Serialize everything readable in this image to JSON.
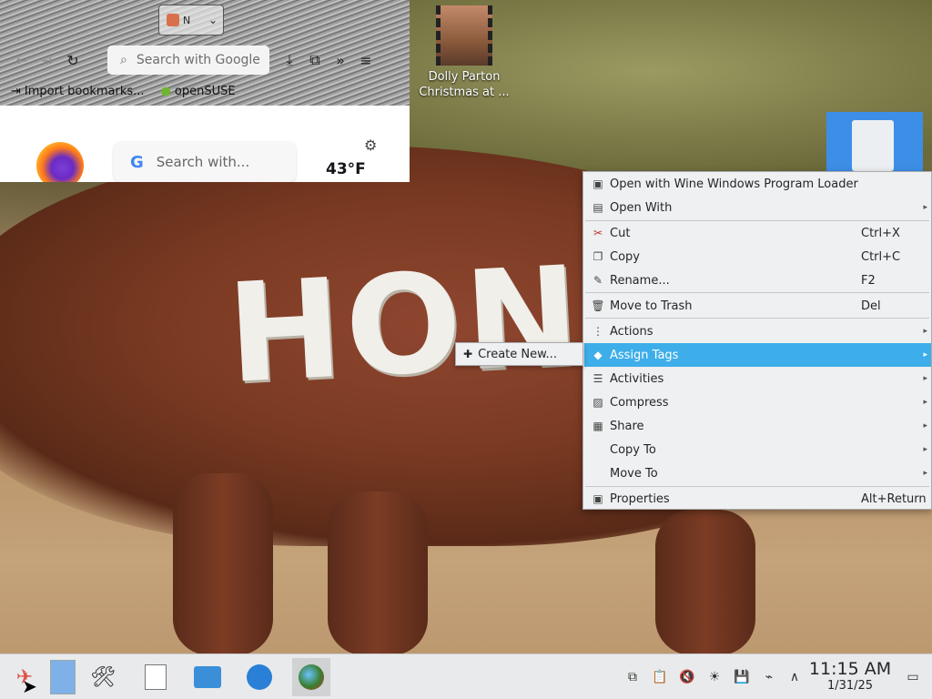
{
  "desktop": {
    "wallpaper_text": "HONS",
    "icon_label": "Dolly Parton Christmas at ..."
  },
  "firefox": {
    "tab_label": "N",
    "url_placeholder": "Search with Google",
    "bookmarks": [
      "Import bookmarks...",
      "openSUSE"
    ],
    "search_placeholder": "Search with...",
    "temperature": "43°F"
  },
  "context_menu": {
    "items": [
      {
        "label": "Open with Wine Windows Program Loader",
        "shortcut": "",
        "icon": "wine-icon",
        "submenu": false
      },
      {
        "label": "Open With",
        "shortcut": "",
        "icon": "open-with-icon",
        "submenu": true
      },
      {
        "label": "Cut",
        "shortcut": "Ctrl+X",
        "icon": "scissors-icon",
        "submenu": false
      },
      {
        "label": "Copy",
        "shortcut": "Ctrl+C",
        "icon": "copy-icon",
        "submenu": false
      },
      {
        "label": "Rename...",
        "shortcut": "F2",
        "icon": "pencil-icon",
        "submenu": false
      },
      {
        "label": "Move to Trash",
        "shortcut": "Del",
        "icon": "trash-icon",
        "submenu": false
      },
      {
        "label": "Actions",
        "shortcut": "",
        "icon": "dots-icon",
        "submenu": true
      },
      {
        "label": "Assign Tags",
        "shortcut": "",
        "icon": "tag-icon",
        "submenu": true,
        "highlighted": true
      },
      {
        "label": "Activities",
        "shortcut": "",
        "icon": "activities-icon",
        "submenu": true
      },
      {
        "label": "Compress",
        "shortcut": "",
        "icon": "compress-icon",
        "submenu": true
      },
      {
        "label": "Share",
        "shortcut": "",
        "icon": "share-icon",
        "submenu": true
      },
      {
        "label": "Copy To",
        "shortcut": "",
        "icon": "",
        "submenu": true
      },
      {
        "label": "Move To",
        "shortcut": "",
        "icon": "",
        "submenu": true
      },
      {
        "label": "Properties",
        "shortcut": "Alt+Return",
        "icon": "properties-icon",
        "submenu": false
      }
    ],
    "highlight_color": "#3daee9"
  },
  "tags_submenu": {
    "item": "Create New..."
  },
  "taskbar": {
    "time": "11:15 AM",
    "date": "1/31/25"
  }
}
